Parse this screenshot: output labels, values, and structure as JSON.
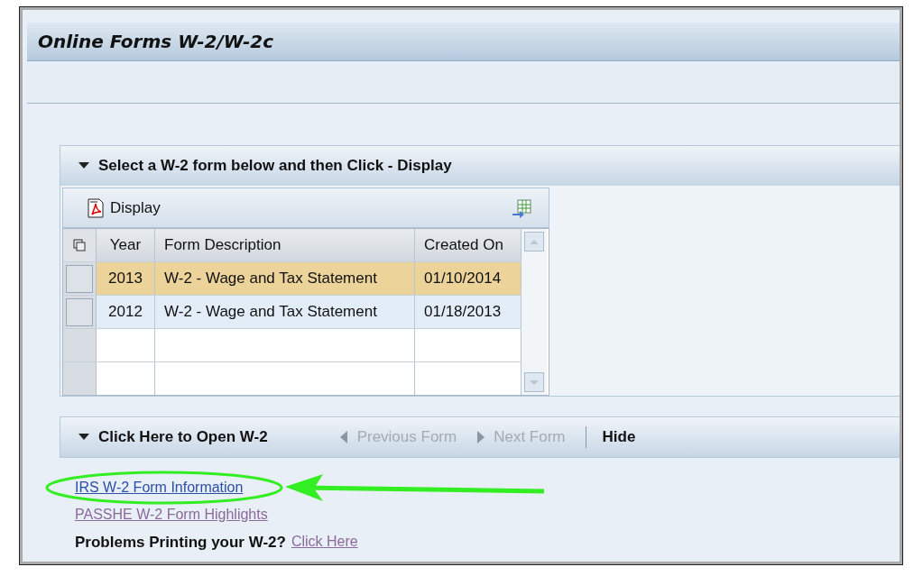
{
  "window": {
    "title": "Online Forms W-2/W-2c"
  },
  "form_panel": {
    "title": "Select a W-2 form below and then Click - Display",
    "expanded": true,
    "toolbar": {
      "display_button": "Display"
    },
    "table": {
      "columns": [
        "Year",
        "Form Description",
        "Created On"
      ],
      "rows": [
        {
          "cells": [
            "2013",
            "W-2 - Wage and Tax Statement",
            "01/10/2014"
          ],
          "selected": true
        },
        {
          "cells": [
            "2012",
            "W-2 - Wage and Tax Statement",
            "01/18/2013"
          ],
          "selected": false
        }
      ]
    }
  },
  "open_panel": {
    "title": "Click Here to Open W-2",
    "expanded": true,
    "nav": [
      {
        "label": "Previous Form",
        "kind": "prev",
        "disabled": true
      },
      {
        "label": "Next Form",
        "kind": "next",
        "disabled": true
      },
      {
        "label": "Hide",
        "kind": "plain",
        "disabled": false
      }
    ],
    "links": [
      {
        "label": "IRS W-2 Form Information",
        "visited": false
      },
      {
        "label": "PASSHE W-2 Form Highlights",
        "visited": true
      }
    ],
    "problem": {
      "text": "Problems Printing your W-2?",
      "link": {
        "label": "Click Here",
        "visited": true
      }
    }
  }
}
